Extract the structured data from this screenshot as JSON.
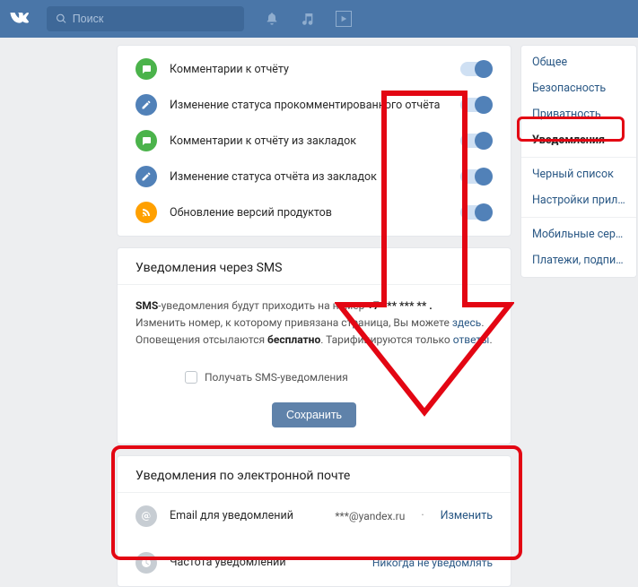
{
  "header": {
    "search_placeholder": "Поиск"
  },
  "notif_rows": [
    {
      "icon": "comment",
      "color": "green",
      "label": "Комментарии к отчёту"
    },
    {
      "icon": "pencil",
      "color": "blue",
      "label": "Изменение статуса прокомментированного отчёта"
    },
    {
      "icon": "comment",
      "color": "green",
      "label": "Комментарии к отчёту из закладок"
    },
    {
      "icon": "pencil",
      "color": "blue",
      "label": "Изменение статуса отчёта из закладок"
    },
    {
      "icon": "rss",
      "color": "orange",
      "label": "Обновление версий продуктов"
    }
  ],
  "sms": {
    "title": "Уведомления через SMS",
    "line1_prefix": "SMS",
    "line1_text": "-уведомления будут приходить на номер ",
    "phone": "+7 *** *** ** .",
    "line2_a": "Изменить номер, к которому привязана страница, Вы можете ",
    "line2_link": "здесь",
    "line2_dot": ".",
    "line3_a": "Оповещения отсылаются ",
    "line3_bold": "бесплатно",
    "line3_b": ". Тарифицируются только ",
    "line3_link": "ответы",
    "line3_dot": ".",
    "checkbox_label": "Получать SMS-уведомления",
    "save_button": "Сохранить"
  },
  "email": {
    "title": "Уведомления по электронной почте",
    "row1_label": "Email для уведомлений",
    "row1_value": "***@yandex.ru",
    "row1_action": "Изменить",
    "row2_label": "Частота уведомлений",
    "row2_value": "Никогда не уведомлять"
  },
  "sidebar": {
    "items": [
      "Общее",
      "Безопасность",
      "Приватность",
      "Уведомления",
      "Черный список",
      "Настройки приложений",
      "Мобильные сервисы",
      "Платежи, подписки, переводы"
    ],
    "active_index": 3
  }
}
